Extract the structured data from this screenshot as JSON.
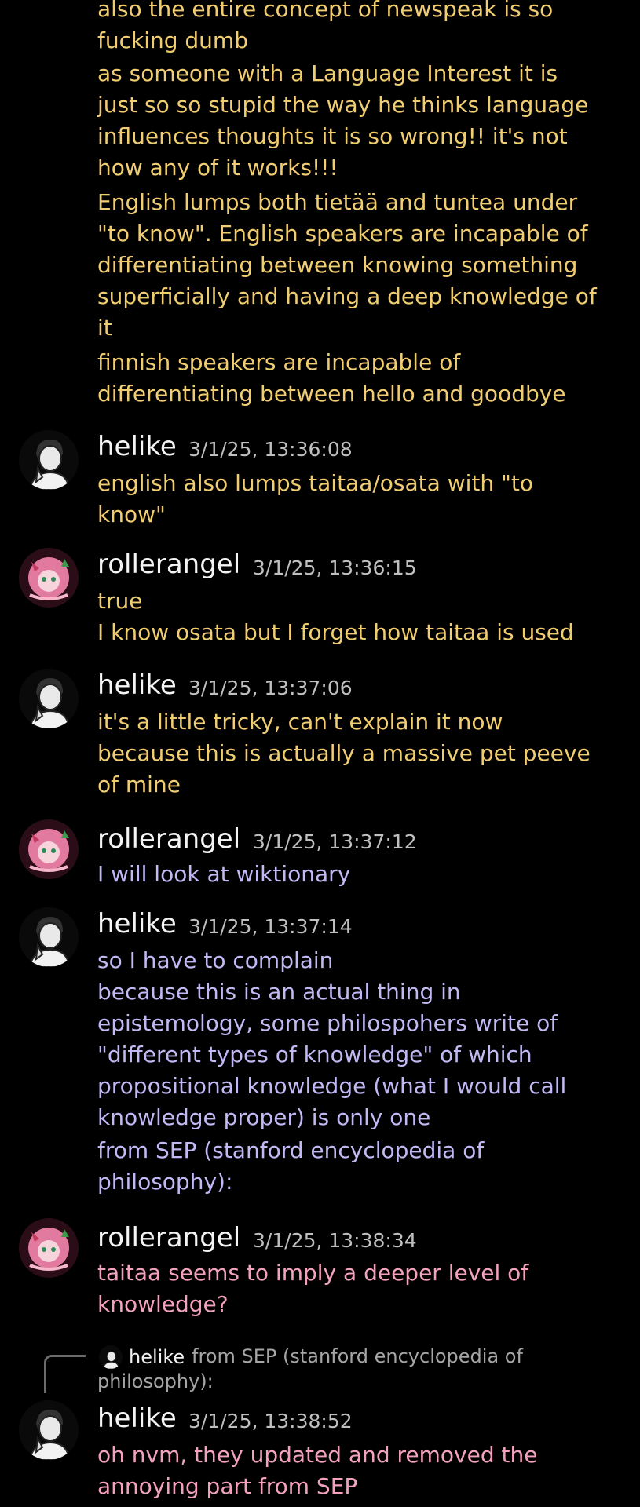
{
  "messages_top": {
    "lines": [
      "also the entire concept of newspeak is so",
      "fucking dumb",
      "as someone with a Language Interest it is",
      "just so so stupid the way he thinks language",
      "influences thoughts it is so wrong!! it's not",
      "how any of it works!!!",
      "English lumps both tietää and tuntea under",
      "\"to know\". English speakers are incapable of",
      "differentiating between knowing something",
      "superficially and having a deep knowledge of",
      "it",
      "finnish speakers are incapable of",
      "differentiating between hello and goodbye"
    ]
  },
  "groups": [
    {
      "author": "helike",
      "timestamp": "3/1/25, 13:36:08",
      "lines": [
        "english also lumps taitaa/osata with \"to",
        "know\""
      ]
    },
    {
      "author": "rollerangel",
      "timestamp": "3/1/25, 13:36:15",
      "lines": [
        "true",
        "I know osata but I forget how taitaa is used"
      ]
    },
    {
      "author": "helike",
      "timestamp": "3/1/25, 13:37:06",
      "lines": [
        "it's a little tricky, can't explain it now",
        "because this is actually a massive pet peeve",
        "of mine"
      ]
    },
    {
      "author": "rollerangel",
      "timestamp": "3/1/25, 13:37:12",
      "lines": [
        "I will look at wiktionary"
      ]
    },
    {
      "author": "helike",
      "timestamp": "3/1/25, 13:37:14",
      "lines": [
        "so I have to complain",
        "because this is an actual thing in",
        "epistemology, some philospohers write of",
        "\"different types of knowledge\" of which",
        "propositional knowledge (what I would call",
        "knowledge proper) is only one",
        "from SEP (stanford encyclopedia of",
        "philosophy):"
      ]
    },
    {
      "author": "rollerangel",
      "timestamp": "3/1/25, 13:38:34",
      "lines": [
        "taitaa seems to imply a deeper level of",
        "knowledge?"
      ]
    },
    {
      "author": "helike",
      "timestamp": "3/1/25, 13:38:52",
      "lines": [
        "oh nvm, they updated and removed the",
        "annoying part from SEP"
      ]
    }
  ],
  "reply": {
    "author": "helike",
    "text_line1": "from SEP (stanford encyclopedia of",
    "text_line2": "philosophy):"
  },
  "colors": {
    "background": "#000000",
    "yellow_text": "#f1cd72",
    "lavender_text": "#c2b8f4",
    "pink_text": "#f3a2bd",
    "timestamp": "#bfbfbf"
  }
}
